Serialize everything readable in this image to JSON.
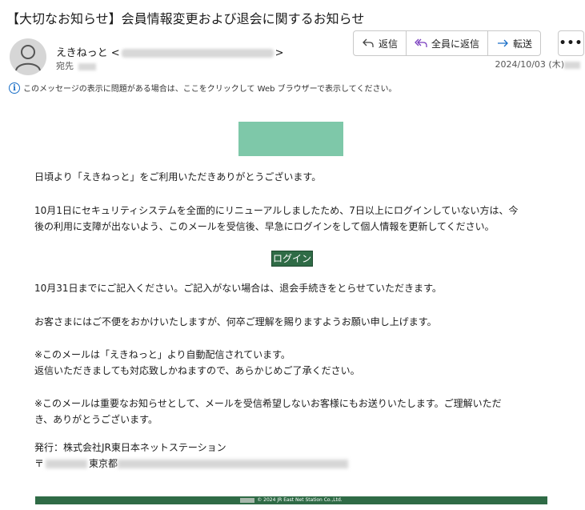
{
  "subject": "【大切なお知らせ】会員情報変更および退会に関するお知らせ",
  "sender": {
    "name": "えきねっと",
    "open": "<",
    "close": ">"
  },
  "to_label": "宛先",
  "actions": {
    "reply": "返信",
    "reply_all": "全員に返信",
    "forward": "転送",
    "more": "•••"
  },
  "date": "2024/10/03 (木)",
  "info_text": "このメッセージの表示に問題がある場合は、ここをクリックして Web ブラウザーで表示してください。",
  "body": {
    "greeting": "日頃より「えきねっと」をご利用いただきありがとうございます。",
    "para1_line1": "10月1日にセキュリティシステムを全面的にリニューアルしましたため、7日以上にログインしていない方は、今",
    "para1_line2": "後の利用に支障が出ないよう、このメールを受信後、早急にログインをして個人情報を更新してください。",
    "login_button": "ログイン",
    "deadline": "10月31日までにご記入ください。ご記入がない場合は、退会手続きをとらせていただきます。",
    "apology": "お客さまにはご不便をおかけいたしますが、何卒ご理解を賜りますようお願い申し上げます。",
    "note1_line1": "※このメールは「えきねっと」より自動配信されています。",
    "note1_line2": "返信いただきましても対応致しかねますので、あらかじめご了承ください。",
    "note2_line1": "※このメールは重要なお知らせとして、メールを受信希望しないお客様にもお送りいたします。ご理解いただ",
    "note2_line2": "き、ありがとうございます。",
    "publisher": "発行：株式会社JR東日本ネットステーション",
    "address_prefix": "〒",
    "address_city": "東京都"
  },
  "footer_text": "© 2024 JR East Net Station Co.,Ltd."
}
